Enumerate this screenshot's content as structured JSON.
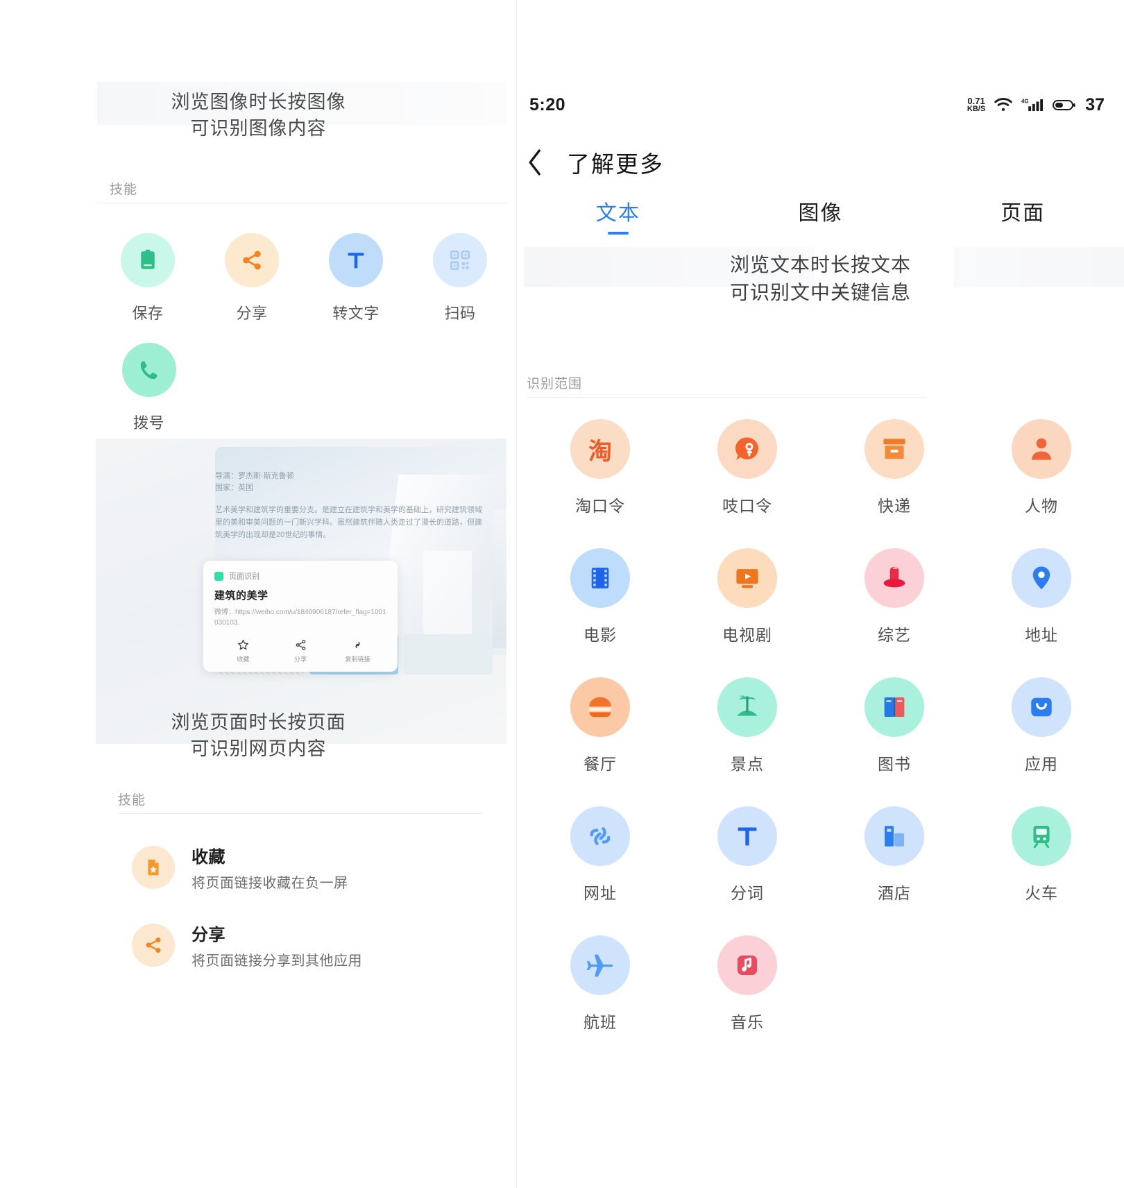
{
  "left_panel": {
    "hero": {
      "line1": "浏览图像时长按图像",
      "line2": "可识别图像内容"
    },
    "skills_label": "技能",
    "skill_icons": [
      {
        "label": "保存",
        "icon": "save-clipboard-icon",
        "bg": "#c9f7e9",
        "fg": "#2fbd8a"
      },
      {
        "label": "分享",
        "icon": "share-nodes-icon",
        "bg": "#fdeace",
        "fg": "#f58220"
      },
      {
        "label": "转文字",
        "icon": "text-t-icon",
        "bg": "#bfdcfb",
        "fg": "#1769e8"
      },
      {
        "label": "扫码",
        "icon": "qr-code-icon",
        "bg": "#dbeafd",
        "fg": "#a8cdf5"
      },
      {
        "label": "拨号",
        "icon": "phone-call-icon",
        "bg": "#9defd4",
        "fg": "#2fbd8a"
      }
    ],
    "preview": {
      "meta_line1": "导演：罗杰斯·斯克鲁顿",
      "meta_line2": "国家：英国",
      "body": "艺术美学和建筑学的重要分支。是建立在建筑学和美学的基础上，研究建筑领域里的美和审美问题的一门新兴学科。虽然建筑伴随人类走过了漫长的道路，但建筑美学的出现却是20世纪的事情。",
      "card": {
        "tag": "页面识别",
        "title": "建筑的美学",
        "url": "微博：https://weibo.com/u/1840906187/refer_flag=1001030103.",
        "actions": [
          {
            "label": "收藏",
            "icon": "star-outline-icon"
          },
          {
            "label": "分享",
            "icon": "share-nodes-icon"
          },
          {
            "label": "复制链接",
            "icon": "link-chain-icon"
          }
        ]
      }
    },
    "hero2": {
      "line1": "浏览页面时长按页面",
      "line2": "可识别网页内容"
    },
    "skills_label2": "技能",
    "skill_list": [
      {
        "title": "收藏",
        "subtitle": "将页面链接收藏在负一屏",
        "icon": "file-star-icon",
        "bg": "#fce7cf",
        "fg": "#f5972a"
      },
      {
        "title": "分享",
        "subtitle": "将页面链接分享到其他应用",
        "icon": "share-nodes-icon",
        "bg": "#fce7cf",
        "fg": "#f58220"
      }
    ]
  },
  "right_panel": {
    "status_bar": {
      "time": "5:20",
      "net_speed_value": "0.71",
      "net_speed_unit": "KB/S",
      "wifi_icon": "wifi-icon",
      "signal_icon": "signal-bars-icon",
      "signal_label": "4G",
      "battery_icon": "battery-icon",
      "battery_level": "37"
    },
    "nav": {
      "back_icon": "chevron-left-icon",
      "title": "了解更多"
    },
    "tabs": [
      {
        "label": "文本",
        "active": true
      },
      {
        "label": "图像",
        "active": false
      },
      {
        "label": "页面",
        "active": false
      }
    ],
    "hero": {
      "line1": "浏览文本时长按文本",
      "line2": "可识别文中关键信息"
    },
    "scope_label": "识别范围",
    "scope_icons": [
      {
        "label": "淘口令",
        "icon": "taobao-code-icon",
        "bg": "#fbdcc5",
        "fg": "#f05a28"
      },
      {
        "label": "吱口令",
        "icon": "alipay-code-icon",
        "bg": "#fcd9c3",
        "fg": "#f4642a"
      },
      {
        "label": "快递",
        "icon": "package-box-icon",
        "bg": "#fcdcc3",
        "fg": "#f07c27"
      },
      {
        "label": "人物",
        "icon": "person-icon",
        "bg": "#fbd7c0",
        "fg": "#f0663a"
      },
      {
        "label": "电影",
        "icon": "film-strip-icon",
        "bg": "#bedcfb",
        "fg": "#1f63e8"
      },
      {
        "label": "电视剧",
        "icon": "tv-play-icon",
        "bg": "#fcdcbd",
        "fg": "#f0751f"
      },
      {
        "label": "综艺",
        "icon": "variety-hat-icon",
        "bg": "#fbd0d6",
        "fg": "#ea2a46"
      },
      {
        "label": "地址",
        "icon": "map-pin-icon",
        "bg": "#cfe3fc",
        "fg": "#2b7df0"
      },
      {
        "label": "餐厅",
        "icon": "burger-food-icon",
        "bg": "#fbc9a5",
        "fg": "#ef6a21"
      },
      {
        "label": "景点",
        "icon": "palm-beach-icon",
        "bg": "#a9f0dd",
        "fg": "#2fbd8a"
      },
      {
        "label": "图书",
        "icon": "open-book-icon",
        "bg": "#a9f0dd",
        "fg": "#2378e8"
      },
      {
        "label": "应用",
        "icon": "app-store-bag-icon",
        "bg": "#cfe3fc",
        "fg": "#2b7df0"
      },
      {
        "label": "网址",
        "icon": "link-chain-icon",
        "bg": "#cfe3fc",
        "fg": "#4f9bf5"
      },
      {
        "label": "分词",
        "icon": "text-t-icon",
        "bg": "#cfe3fc",
        "fg": "#1f63e8"
      },
      {
        "label": "酒店",
        "icon": "hotel-building-icon",
        "bg": "#cfe3fc",
        "fg": "#2b7df0"
      },
      {
        "label": "火车",
        "icon": "train-icon",
        "bg": "#a9f0dd",
        "fg": "#2fbd8a"
      },
      {
        "label": "航班",
        "icon": "airplane-icon",
        "bg": "#cfe3fc",
        "fg": "#4f9bf5"
      },
      {
        "label": "音乐",
        "icon": "music-note-icon",
        "bg": "#fbd0d6",
        "fg": "#ea4a5e"
      }
    ]
  },
  "colors": {
    "accent_blue": "#2c7ff2",
    "orange": "#f58220",
    "green": "#2fbd8a",
    "text_primary": "#1d1d1d",
    "text_secondary": "#6d6d6d",
    "text_muted": "#9b9b9b"
  }
}
